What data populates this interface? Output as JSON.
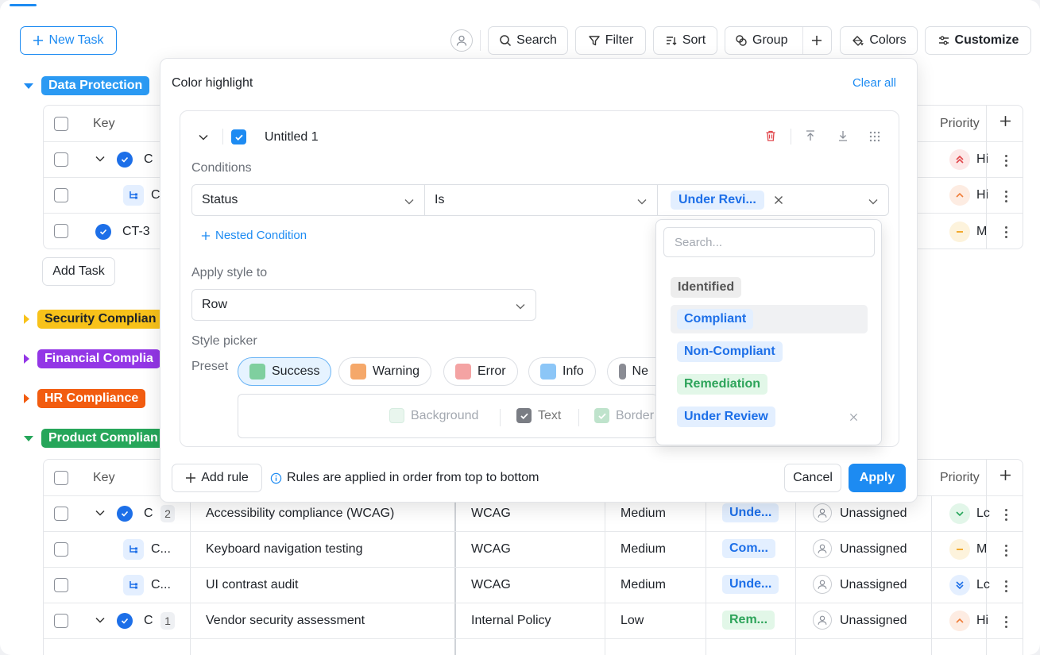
{
  "toolbar": {
    "new_task": "New Task",
    "search": "Search",
    "filter": "Filter",
    "sort": "Sort",
    "group": "Group",
    "colors": "Colors",
    "customize": "Customize"
  },
  "groups": [
    {
      "name": "Data Protection",
      "color": "#2b9af3",
      "expanded": true
    },
    {
      "name": "Security Complian",
      "color": "#f8c21a",
      "text_color": "#1f2329",
      "expanded": false
    },
    {
      "name": "Financial Complia",
      "color": "#9336e6",
      "expanded": false
    },
    {
      "name": "HR Compliance",
      "color": "#f25c10",
      "expanded": false
    },
    {
      "name": "Product Complian",
      "color": "#26a65a",
      "expanded": true
    }
  ],
  "table1": {
    "col_key": "Key",
    "col_priority": "Priority",
    "rows": [
      {
        "key": "C",
        "priority": "Hi"
      },
      {
        "key": "C",
        "priority": "Hi"
      },
      {
        "key": "CT-3",
        "priority": "M"
      }
    ],
    "add_task": "Add Task"
  },
  "table2": {
    "col_key": "Key",
    "col_priority": "Priority",
    "rows": [
      {
        "key": "C",
        "count": "2",
        "title": "Accessibility compliance (WCAG)",
        "standard": "WCAG",
        "severity": "Medium",
        "status": "Unde...",
        "assignee": "Unassigned",
        "priority": "Lc"
      },
      {
        "key": "C...",
        "count": "",
        "title": "Keyboard navigation testing",
        "standard": "WCAG",
        "severity": "Medium",
        "status": "Com...",
        "assignee": "Unassigned",
        "priority": "M"
      },
      {
        "key": "C...",
        "count": "",
        "title": "UI contrast audit",
        "standard": "WCAG",
        "severity": "Medium",
        "status": "Unde...",
        "assignee": "Unassigned",
        "priority": "Lc"
      },
      {
        "key": "C",
        "count": "1",
        "title": "Vendor security assessment",
        "standard": "Internal Policy",
        "severity": "Low",
        "status": "Rem...",
        "assignee": "Unassigned",
        "priority": "Hi"
      }
    ]
  },
  "panel": {
    "title": "Color highlight",
    "clear_all": "Clear all",
    "rule_name": "Untitled 1",
    "conditions_label": "Conditions",
    "field": "Status",
    "operator": "Is",
    "value_tag": "Under Revi...",
    "nested_condition": "Nested Condition",
    "apply_style_label": "Apply style to",
    "apply_style_value": "Row",
    "style_picker_label": "Style picker",
    "preset_label": "Preset",
    "presets": [
      {
        "name": "Success",
        "color": "#7fcf9f"
      },
      {
        "name": "Warning",
        "color": "#f5a86a"
      },
      {
        "name": "Error",
        "color": "#f4a3a3"
      },
      {
        "name": "Info",
        "color": "#8cc6f7"
      },
      {
        "name": "Ne",
        "color": "#8a8c94"
      }
    ],
    "targets": [
      "Background",
      "Text",
      "Border"
    ],
    "add_rule": "Add rule",
    "info_text": "Rules are applied in order from top to bottom",
    "cancel": "Cancel",
    "apply": "Apply"
  },
  "dropdown": {
    "search_placeholder": "Search...",
    "options": [
      {
        "label": "Identified",
        "bg": "#ededed",
        "fg": "#555"
      },
      {
        "label": "Compliant",
        "bg": "#e3efff",
        "fg": "#1d6fe8"
      },
      {
        "label": "Non-Compliant",
        "bg": "#e3efff",
        "fg": "#1d6fe8"
      },
      {
        "label": "Remediation",
        "bg": "#e2f7e8",
        "fg": "#2da45a"
      },
      {
        "label": "Under Review",
        "bg": "#e3efff",
        "fg": "#1d6fe8"
      }
    ]
  }
}
